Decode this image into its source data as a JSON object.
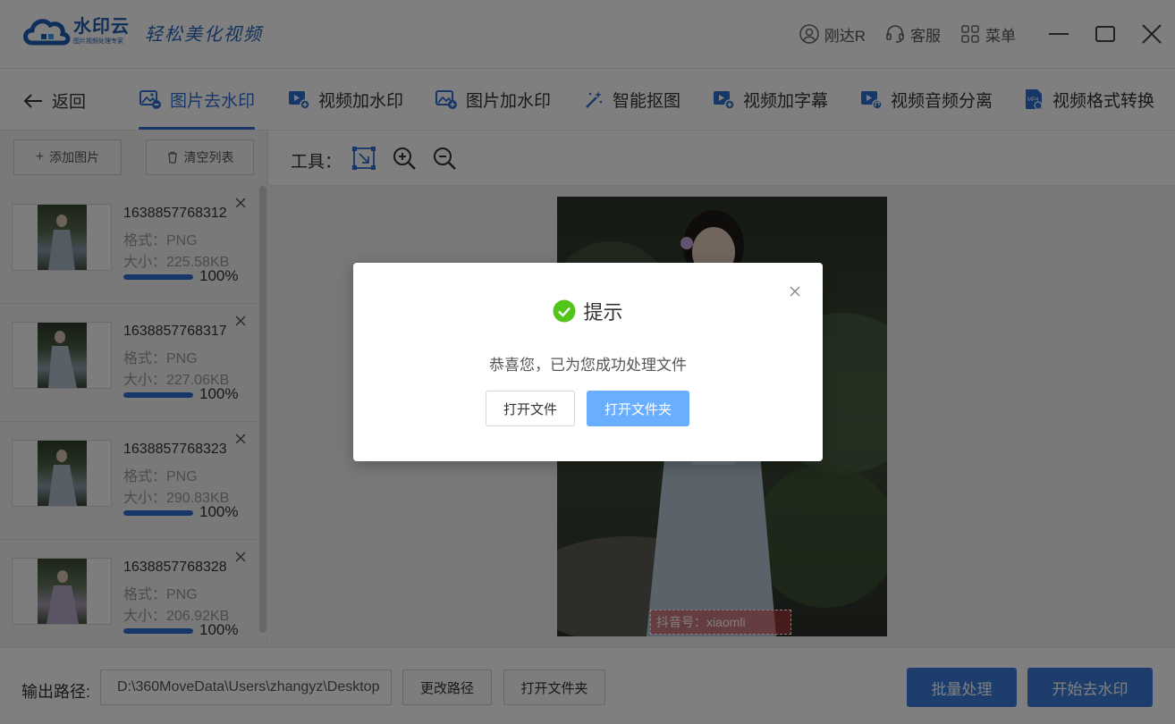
{
  "app": {
    "logo_name": "水印云",
    "logo_sub": "图片视频处理专家",
    "slogan": "轻松美化视频",
    "user_name": "刚达R",
    "support_label": "客服",
    "menu_label": "菜单"
  },
  "nav": {
    "back_label": "返回",
    "tabs": [
      {
        "label": "图片去水印",
        "icon": "image-remove-icon",
        "active": true
      },
      {
        "label": "视频加水印",
        "icon": "video-add-icon",
        "active": false
      },
      {
        "label": "图片加水印",
        "icon": "image-add-icon",
        "active": false
      },
      {
        "label": "智能抠图",
        "icon": "magic-wand-icon",
        "active": false
      },
      {
        "label": "视频加字幕",
        "icon": "video-subtitle-icon",
        "active": false
      },
      {
        "label": "视频音频分离",
        "icon": "video-audio-icon",
        "active": false
      },
      {
        "label": "视频格式转换",
        "icon": "mp4-file-icon",
        "active": false
      }
    ]
  },
  "sidebar": {
    "add_label": "添加图片",
    "clear_label": "清空列表",
    "items": [
      {
        "name": "1638857768312",
        "format": "格式：PNG",
        "size": "大小：225.58KB",
        "progress": 100,
        "percent_label": "100%"
      },
      {
        "name": "1638857768317",
        "format": "格式：PNG",
        "size": "大小：227.06KB",
        "progress": 100,
        "percent_label": "100%"
      },
      {
        "name": "1638857768323",
        "format": "格式：PNG",
        "size": "大小：290.83KB",
        "progress": 100,
        "percent_label": "100%"
      },
      {
        "name": "1638857768328",
        "format": "格式：PNG",
        "size": "大小：206.92KB",
        "progress": 100,
        "percent_label": "100%"
      }
    ]
  },
  "toolbar": {
    "label": "工具："
  },
  "canvas": {
    "watermark_text": "抖音号：xiaomli"
  },
  "footer": {
    "output_label": "输出路径:",
    "output_path": "D:\\360MoveData\\Users\\zhangyz\\Desktop",
    "change_path_label": "更改路径",
    "open_folder_label": "打开文件夹",
    "batch_label": "批量处理",
    "start_label": "开始去水印"
  },
  "dialog": {
    "title": "提示",
    "message": "恭喜您，已为您成功处理文件",
    "open_file_label": "打开文件",
    "open_folder_label": "打开文件夹"
  },
  "colors": {
    "accent": "#2e6fd0",
    "primary_button": "#3b7dd8",
    "dialog_button": "#6aaeff",
    "success": "#52c41a"
  }
}
